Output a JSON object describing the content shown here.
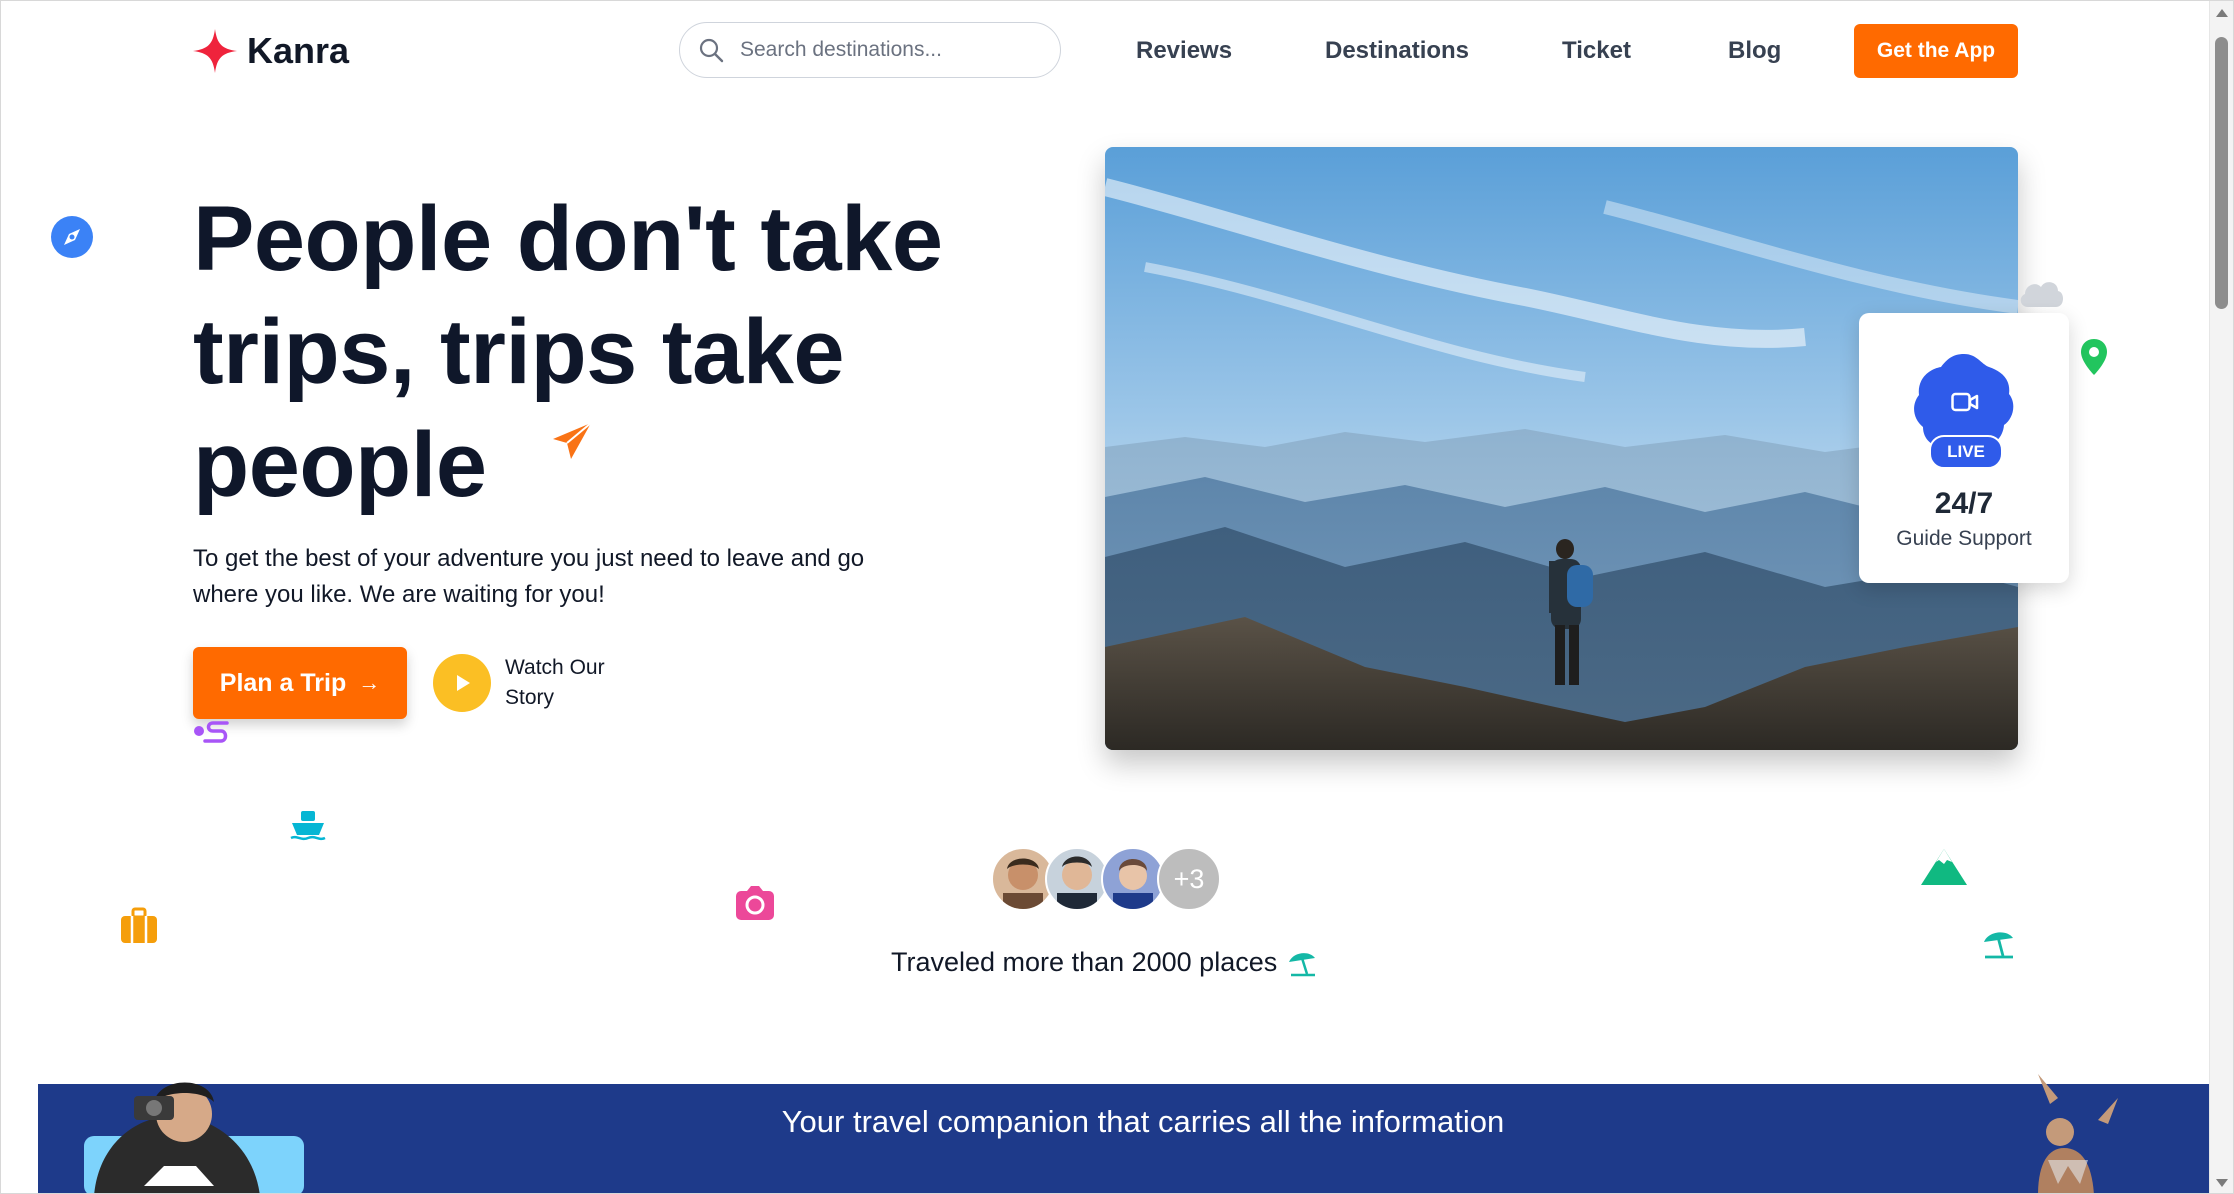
{
  "header": {
    "brand": "Kanra",
    "search_placeholder": "Search destinations...",
    "nav": [
      {
        "label": "Reviews"
      },
      {
        "label": "Destinations"
      },
      {
        "label": "Ticket"
      },
      {
        "label": "Blog"
      }
    ],
    "cta_label": "Get the App"
  },
  "hero": {
    "headline": "People don't take trips, trips take people",
    "subtext": "To get the best of your adventure you just need to leave and go where you like. We are waiting for you!",
    "plan_button_label": "Plan a Trip",
    "plan_button_arrow": "→",
    "watch_label": "Watch Our Story"
  },
  "live_card": {
    "badge": "LIVE",
    "stat": "24/7",
    "label": "Guide Support"
  },
  "travelers": {
    "more_count": "+3",
    "text": "Traveled more than 2000 places"
  },
  "banner": {
    "text": "Your travel companion that carries all the information"
  },
  "colors": {
    "accent": "#ff6a00",
    "brand_star": "#ef233c",
    "play": "#fbbf24",
    "live_blue": "#2f5bea",
    "banner": "#1e3a8a"
  },
  "icons": [
    "star-logo-icon",
    "search-icon",
    "compass-icon",
    "paper-plane-icon",
    "route-icon",
    "ship-icon",
    "suitcase-icon",
    "camera-icon",
    "cloud-icon",
    "map-pin-icon",
    "mountain-icon",
    "beach-umbrella-icon",
    "video-camera-icon",
    "play-icon"
  ]
}
